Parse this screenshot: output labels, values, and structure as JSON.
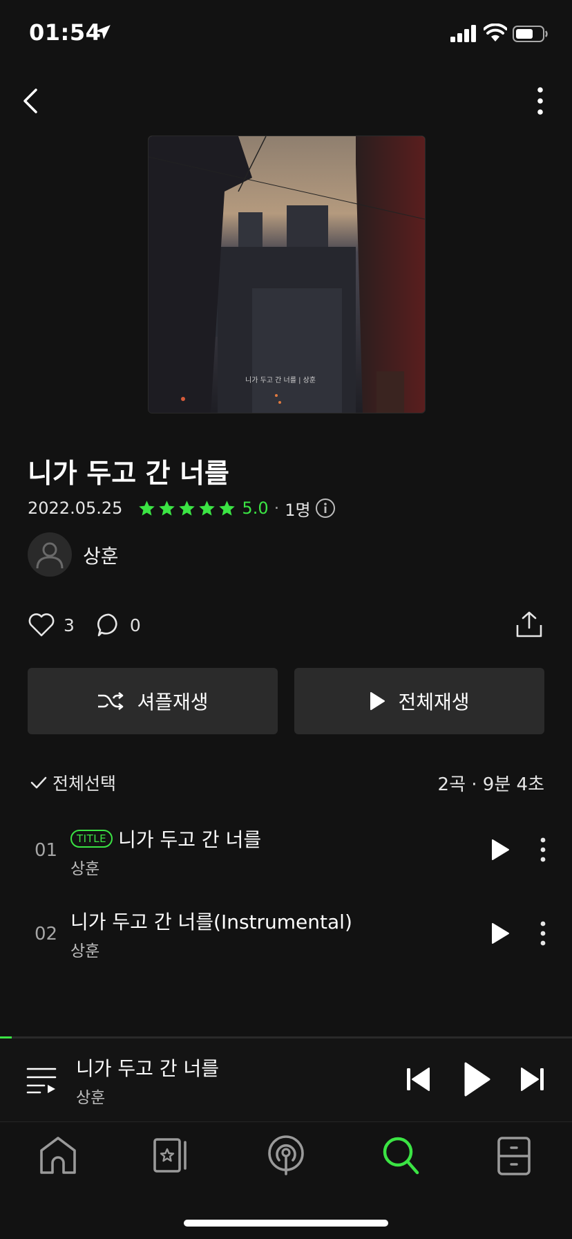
{
  "status_bar": {
    "time": "01:54"
  },
  "album": {
    "title": "니가 두고 간 너를",
    "release_date": "2022.05.25",
    "rating": "5.0",
    "rating_count": "1명",
    "stars": 5,
    "artist": "상훈",
    "likes": "3",
    "comments": "0",
    "cover_text": "니가 두고 간 너를 | 상훈"
  },
  "buttons": {
    "shuffle": "셔플재생",
    "play_all": "전체재생"
  },
  "list_header": {
    "select_all": "전체선택",
    "summary": "2곡 · 9분 4초"
  },
  "tracks": [
    {
      "number": "01",
      "badge": "TITLE",
      "title": "니가 두고 간 너를",
      "artist": "상훈"
    },
    {
      "number": "02",
      "badge": "",
      "title": "니가 두고 간 너를(Instrumental)",
      "artist": "상훈"
    }
  ],
  "mini_player": {
    "title": "니가 두고 간 너를",
    "artist": "상훈",
    "progress": 0.02
  },
  "tabs": [
    {
      "name": "home",
      "icon": "home-icon",
      "active": false
    },
    {
      "name": "library",
      "icon": "star-card-icon",
      "active": false
    },
    {
      "name": "podcast",
      "icon": "podcast-icon",
      "active": false
    },
    {
      "name": "search",
      "icon": "search-icon",
      "active": true
    },
    {
      "name": "storage",
      "icon": "drawer-icon",
      "active": false
    }
  ],
  "colors": {
    "accent": "#3be444",
    "background": "#121212",
    "button": "#2b2b2b"
  }
}
